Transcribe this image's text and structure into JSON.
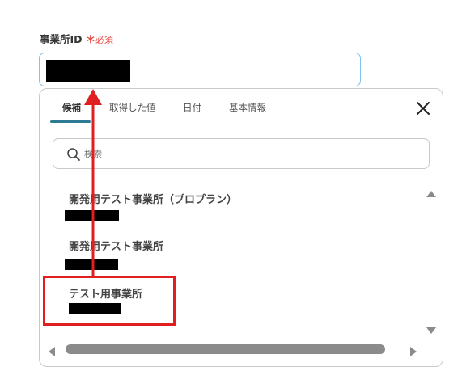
{
  "field": {
    "label": "事業所ID",
    "required_mark": "＊",
    "required_text": "必須"
  },
  "dropdown": {
    "tabs": [
      {
        "label": "候補",
        "active": true
      },
      {
        "label": "取得した値",
        "active": false
      },
      {
        "label": "日付",
        "active": false
      },
      {
        "label": "基本情報",
        "active": false
      }
    ],
    "close_icon": "close-icon",
    "search": {
      "placeholder": "検索",
      "value": ""
    },
    "options": [
      {
        "label": "開発用テスト事業所（プロプラン）"
      },
      {
        "label": "開発用テスト事業所"
      },
      {
        "label": "テスト用事業所"
      }
    ]
  },
  "colors": {
    "accent": "#2c7a93",
    "focus_border": "#7fc3ef",
    "required": "#e8473f",
    "annotation": "#e02020"
  }
}
